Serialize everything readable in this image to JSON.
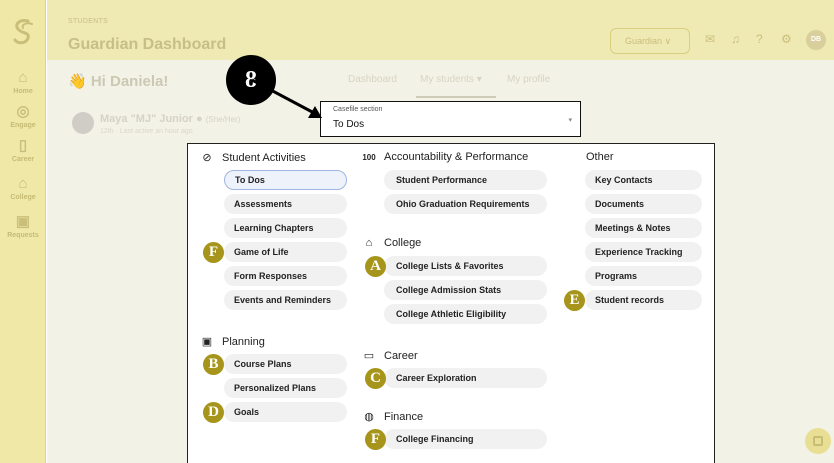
{
  "sidebar": {
    "items": [
      {
        "label": "Home",
        "icon": "home-icon"
      },
      {
        "label": "Engage",
        "icon": "engage-icon"
      },
      {
        "label": "Career",
        "icon": "briefcase-icon"
      },
      {
        "label": "College",
        "icon": "college-icon"
      },
      {
        "label": "Requests",
        "icon": "inbox-icon"
      }
    ]
  },
  "header": {
    "breadcrumb": "STUDENTS",
    "title": "Guardian Dashboard",
    "role_select": "Guardian",
    "avatar_initials": "DB"
  },
  "greeting": "👋 Hi Daniela!",
  "tabs": [
    {
      "label": "Dashboard"
    },
    {
      "label": "My students ▾"
    },
    {
      "label": "My profile"
    }
  ],
  "student": {
    "name": "Maya \"MJ\" Junior",
    "pronouns": "(She/Her)",
    "meta": "12th · Last active an hour ago"
  },
  "casefile": {
    "label": "Casefile section",
    "value": "To Dos"
  },
  "callout": "8",
  "sections": {
    "student_activities": {
      "title": "Student Activities",
      "items": [
        "To Dos",
        "Assessments",
        "Learning Chapters",
        "Game of Life",
        "Form Responses",
        "Events and Reminders"
      ]
    },
    "planning": {
      "title": "Planning",
      "items": [
        "Course Plans",
        "Personalized Plans",
        "Goals"
      ]
    },
    "accountability": {
      "title": "Accountability & Performance",
      "items": [
        "Student Performance",
        "Ohio Graduation Requirements"
      ]
    },
    "college": {
      "title": "College",
      "items": [
        "College Lists & Favorites",
        "College Admission Stats",
        "College Athletic Eligibility"
      ]
    },
    "career": {
      "title": "Career",
      "items": [
        "Career Exploration"
      ]
    },
    "finance": {
      "title": "Finance",
      "items": [
        "College Financing"
      ]
    },
    "other": {
      "title": "Other",
      "items": [
        "Key Contacts",
        "Documents",
        "Meetings & Notes",
        "Experience Tracking",
        "Programs",
        "Student records"
      ]
    }
  },
  "badges": {
    "game_of_life": "F",
    "course_plans": "B",
    "goals": "D",
    "college_lists": "A",
    "career_exploration": "C",
    "college_financing": "F",
    "student_records": "E"
  },
  "colors": {
    "sidebar_bg": "#efe8a6",
    "badge": "#a6951a",
    "selected_border": "#9fb5e3"
  }
}
